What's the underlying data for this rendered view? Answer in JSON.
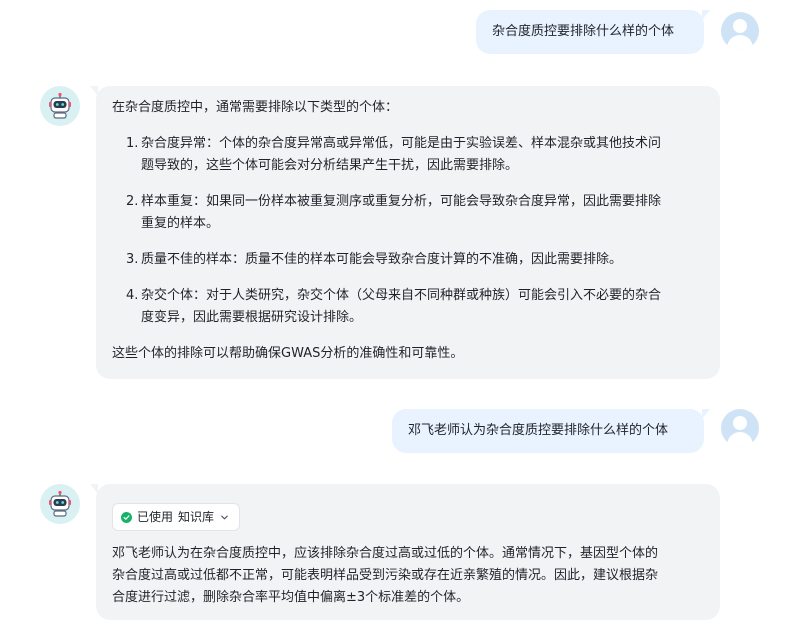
{
  "messages": [
    {
      "role": "user",
      "text": "杂合度质控要排除什么样的个体"
    },
    {
      "role": "assistant",
      "intro": "在杂合度质控中，通常需要排除以下类型的个体：",
      "items": [
        {
          "num": "1.",
          "line1": "杂合度异常：个体的杂合度异常高或异常低，可能是由于实验误差、样本混杂或其他技术问",
          "line2": "题导致的，这些个体可能会对分析结果产生干扰，因此需要排除。"
        },
        {
          "num": "2.",
          "line1": "样本重复：如果同一份样本被重复测序或重复分析，可能会导致杂合度异常，因此需要排除",
          "line2": "重复的样本。"
        },
        {
          "num": "3.",
          "line1": "质量不佳的样本：质量不佳的样本可能会导致杂合度计算的不准确，因此需要排除。",
          "line2": ""
        },
        {
          "num": "4.",
          "line1": "杂交个体：对于人类研究，杂交个体（父母来自不同种群或种族）可能会引入不必要的杂合",
          "line2": "度变异，因此需要根据研究设计排除。"
        }
      ],
      "outro": "这些个体的排除可以帮助确保GWAS分析的准确性和可靠性。"
    },
    {
      "role": "user",
      "text": "邓飞老师认为杂合度质控要排除什么样的个体"
    },
    {
      "role": "assistant",
      "kb_status": "已使用",
      "kb_name": "知识库",
      "lines": [
        "邓飞老师认为在杂合度质控中，应该排除杂合度过高或过低的个体。通常情况下，基因型个体的",
        "杂合度过高或过低都不正常，可能表明样品受到污染或存在近亲繁殖的情况。因此，建议根据杂",
        "合度进行过滤，删除杂合率平均值中偏离±3个标准差的个体。"
      ]
    }
  ],
  "colors": {
    "user_bubble": "#e8f3ff",
    "bot_bubble": "#f2f3f5",
    "check_green": "#17b26a"
  },
  "icons": {
    "user_avatar": "user-avatar-icon",
    "bot_avatar": "robot-icon",
    "kb_check": "check-circle-icon",
    "kb_chevron": "chevron-down-icon"
  }
}
